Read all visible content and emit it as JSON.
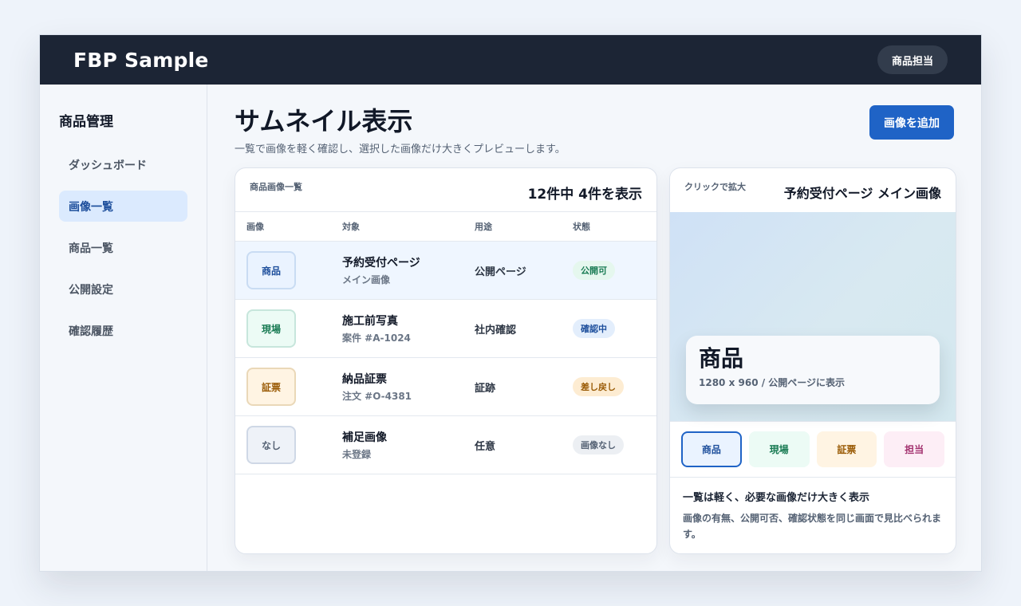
{
  "app": {
    "title": "FBP Sample",
    "role": "商品担当"
  },
  "sidebar": {
    "title": "商品管理",
    "items": [
      {
        "label": "ダッシュボード"
      },
      {
        "label": "画像一覧"
      },
      {
        "label": "商品一覧"
      },
      {
        "label": "公開設定"
      },
      {
        "label": "確認履歴"
      }
    ]
  },
  "page": {
    "title": "サムネイル表示",
    "description": "一覧で画像を軽く確認し、選択した画像だけ大きくプレビューします。",
    "add_button": "画像を追加"
  },
  "list": {
    "label": "商品画像一覧",
    "count": "12件中 4件を表示",
    "columns": [
      "画像",
      "対象",
      "用途",
      "状態"
    ],
    "rows": [
      {
        "thumb": "商品",
        "target": "予約受付ページ",
        "sub": "メイン画像",
        "usage": "公開ページ",
        "status": "公開可"
      },
      {
        "thumb": "現場",
        "target": "施工前写真",
        "sub": "案件 #A-1024",
        "usage": "社内確認",
        "status": "確認中"
      },
      {
        "thumb": "証票",
        "target": "納品証票",
        "sub": "注文 #O-4381",
        "usage": "証跡",
        "status": "差し戻し"
      },
      {
        "thumb": "なし",
        "target": "補足画像",
        "sub": "未登録",
        "usage": "任意",
        "status": "画像なし"
      }
    ]
  },
  "preview": {
    "label": "クリックで拡大",
    "title": "予約受付ページ メイン画像",
    "caption_main": "商品",
    "caption_sub": "1280 x 960 / 公開ページに表示",
    "chips": [
      "商品",
      "現場",
      "証票",
      "担当"
    ],
    "note_title": "一覧は軽く、必要な画像だけ大きく表示",
    "note_body": "画像の有無、公開可否、確認状態を同じ画面で見比べられます。"
  },
  "colors": {
    "topbar": "#1c2535",
    "accent": "#1f63c6",
    "status_ok": "#177a52",
    "status_review": "#1e4f9c",
    "status_returned": "#9a5b06",
    "status_none": "#556274"
  }
}
